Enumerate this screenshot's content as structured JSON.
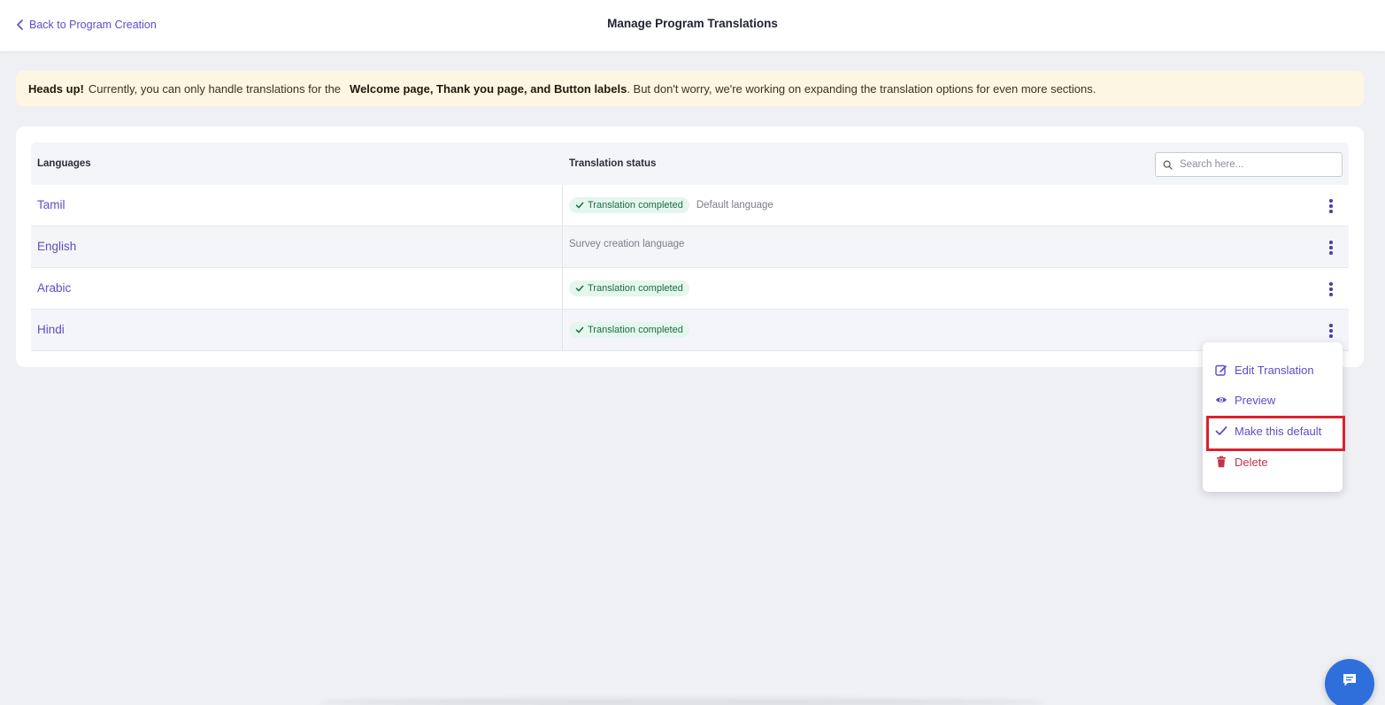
{
  "header": {
    "back_label": "Back to Program Creation",
    "title": "Manage Program Translations"
  },
  "banner": {
    "lead": "Heads up!",
    "text1": "Currently, you can only handle translations for the",
    "bold": "Welcome page, Thank you page, and Button labels",
    "text2": ". But don't worry, we're working on expanding the translation options for even more sections."
  },
  "table": {
    "col_languages": "Languages",
    "col_status": "Translation status",
    "search_placeholder": "Search here...",
    "rows": [
      {
        "language": "Tamil",
        "status": "Translation completed",
        "note": "Default language"
      },
      {
        "language": "English",
        "status": "",
        "note": "Survey creation language"
      },
      {
        "language": "Arabic",
        "status": "Translation completed",
        "note": ""
      },
      {
        "language": "Hindi",
        "status": "Translation completed",
        "note": ""
      }
    ]
  },
  "menu": {
    "edit": "Edit Translation",
    "preview": "Preview",
    "make_default": "Make this default",
    "delete": "Delete"
  },
  "colors": {
    "accent": "#5b4fc4",
    "success_bg": "#e4f6ee",
    "success_text": "#1d6b4a",
    "danger": "#c4334a",
    "highlight": "#d8222f",
    "chat": "#2f6fdc"
  },
  "icons": {
    "back": "chevron-left-icon",
    "search": "search-icon",
    "check": "check-icon",
    "kebab": "more-vertical-icon",
    "edit": "edit-icon",
    "preview": "eye-icon",
    "make_default": "check-icon",
    "delete": "trash-icon",
    "chat": "chat-icon"
  }
}
